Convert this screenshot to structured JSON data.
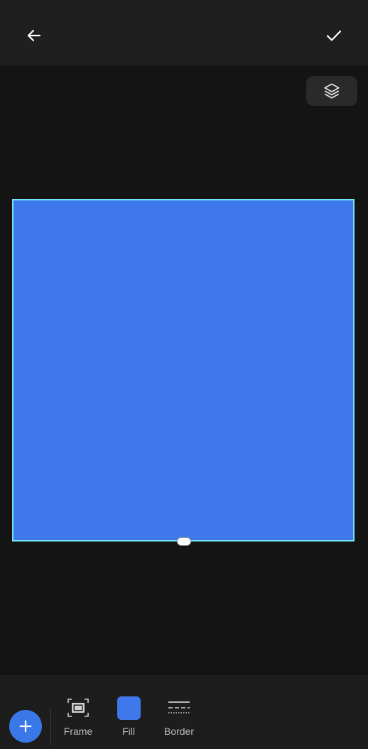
{
  "topbar": {
    "back_icon": "arrow-left-icon",
    "confirm_icon": "checkmark-icon"
  },
  "canvas": {
    "layers_icon": "layers-icon",
    "shape": {
      "fill_color": "#3e78ea",
      "selection_color": "#73e6f3"
    }
  },
  "toolbar": {
    "add_icon": "plus-icon",
    "accent_color": "#3a78ea",
    "tools": [
      {
        "label": "Frame",
        "icon": "frame-icon"
      },
      {
        "label": "Fill",
        "icon": "fill-swatch-icon"
      },
      {
        "label": "Border",
        "icon": "border-icon"
      }
    ]
  }
}
